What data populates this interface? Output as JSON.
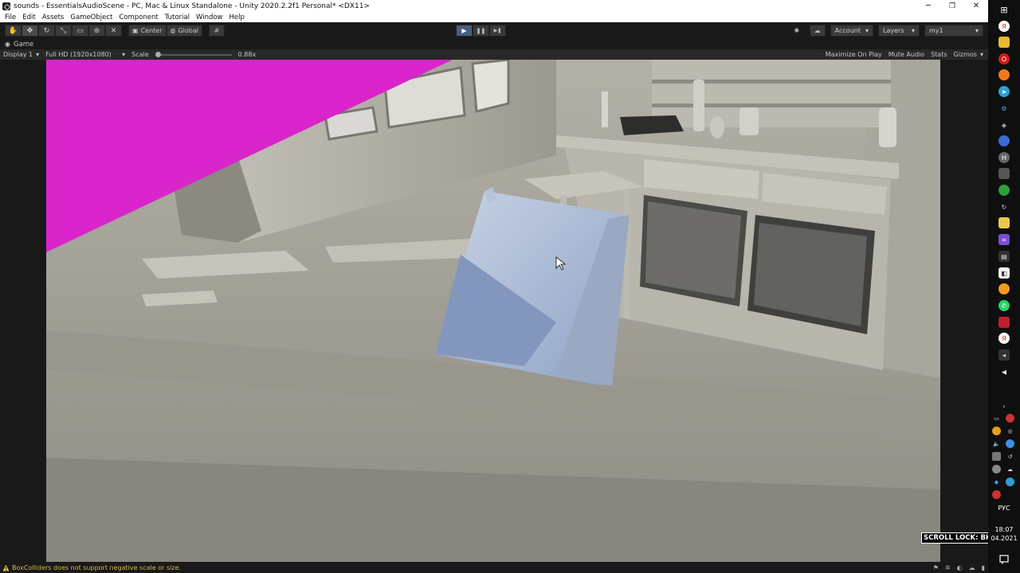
{
  "window": {
    "title": "sounds - EssentialsAudioScene - PC, Mac & Linux Standalone - Unity 2020.2.2f1 Personal* <DX11>",
    "minimize": "─",
    "maximize": "❐",
    "close": "✕"
  },
  "menu": [
    "File",
    "Edit",
    "Assets",
    "GameObject",
    "Component",
    "Tutorial",
    "Window",
    "Help"
  ],
  "toolbar": {
    "tools": [
      "hand-icon",
      "move-icon",
      "rotate-icon",
      "scale-icon",
      "rect-icon",
      "transform-icon",
      "custom-tool-icon"
    ],
    "pivot_label": "Center",
    "space_label": "Global",
    "grid_icon": "grid-snap-icon",
    "play": "▶",
    "pause": "❚❚",
    "step": "▶❚",
    "account_label": "Account",
    "layers_label": "Layers",
    "layout_label": "my1"
  },
  "game_tab": {
    "label": "Game"
  },
  "game_bar": {
    "display": "Display 1",
    "resolution": "Full HD (1920x1080)",
    "scale_label": "Scale",
    "scale_value": "0.88x",
    "scale_fraction": 0.0,
    "maximize_on_play": "Maximize On Play",
    "mute_audio": "Mute Audio",
    "stats": "Stats",
    "gizmos": "Gizmos"
  },
  "status": {
    "message": "BoxColliders does not support negative scale or size."
  },
  "overlay": {
    "scroll_lock": "SCROLL LOCK: ВКЛ."
  },
  "taskbar": {
    "language": "РУС",
    "time": "18:07",
    "date": "04.2021",
    "colors": {
      "magenta": "#d925cb",
      "play_active": "#46607e",
      "warning": "#d6b94a"
    }
  }
}
